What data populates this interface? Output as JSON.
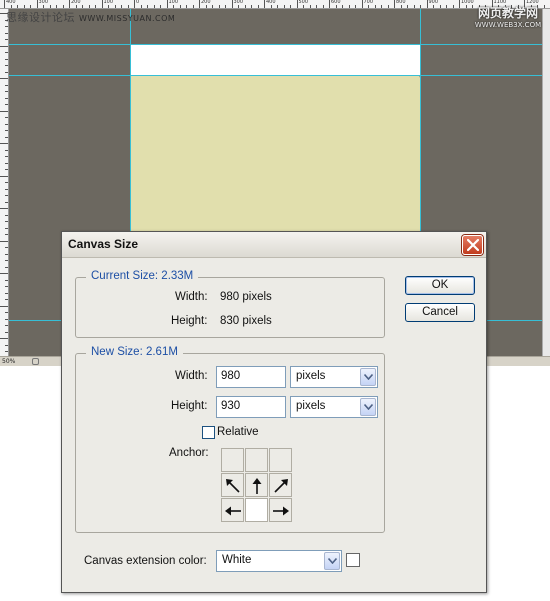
{
  "watermark": {
    "left_text": "思缘设计论坛",
    "left_url": "WWW.MISSYUAN.COM",
    "right_title": "网页教学网",
    "right_url": "WWW.WEB3X.COM"
  },
  "ruler": {
    "top_numbers": [
      "400",
      "300",
      "200",
      "100",
      "0",
      "100",
      "200",
      "300",
      "400",
      "500",
      "600",
      "700",
      "800",
      "900",
      "1000",
      "1100",
      "1200",
      "1300"
    ]
  },
  "status_bar": {
    "zoom": "50%"
  },
  "dialog": {
    "title": "Canvas Size",
    "current_size": {
      "label": "Current Size: 2.33M",
      "width_label": "Width:",
      "width_value": "980 pixels",
      "height_label": "Height:",
      "height_value": "830 pixels"
    },
    "new_size": {
      "label": "New Size: 2.61M",
      "width_label": "Width:",
      "width_value": "980",
      "width_unit": "pixels",
      "height_label": "Height:",
      "height_value": "930",
      "height_unit": "pixels",
      "relative_label": "Relative",
      "relative_checked": false,
      "anchor_label": "Anchor:",
      "anchor_icons": [
        "blank",
        "blank",
        "blank",
        "arrow-up-left-icon",
        "arrow-up-icon",
        "arrow-up-right-icon",
        "arrow-left-icon",
        "anchor-center",
        "arrow-right-icon"
      ]
    },
    "extension": {
      "label": "Canvas extension color:",
      "value": "White",
      "swatch_color": "#ffffff"
    },
    "buttons": {
      "ok": "OK",
      "cancel": "Cancel"
    }
  },
  "colors": {
    "canvas_gray": "#6c6860",
    "document_yellow": "#e1dfad",
    "guide_cyan": "#37bfd6",
    "group_label_blue": "#1d4fa5",
    "close_red": "#c13c1e"
  }
}
